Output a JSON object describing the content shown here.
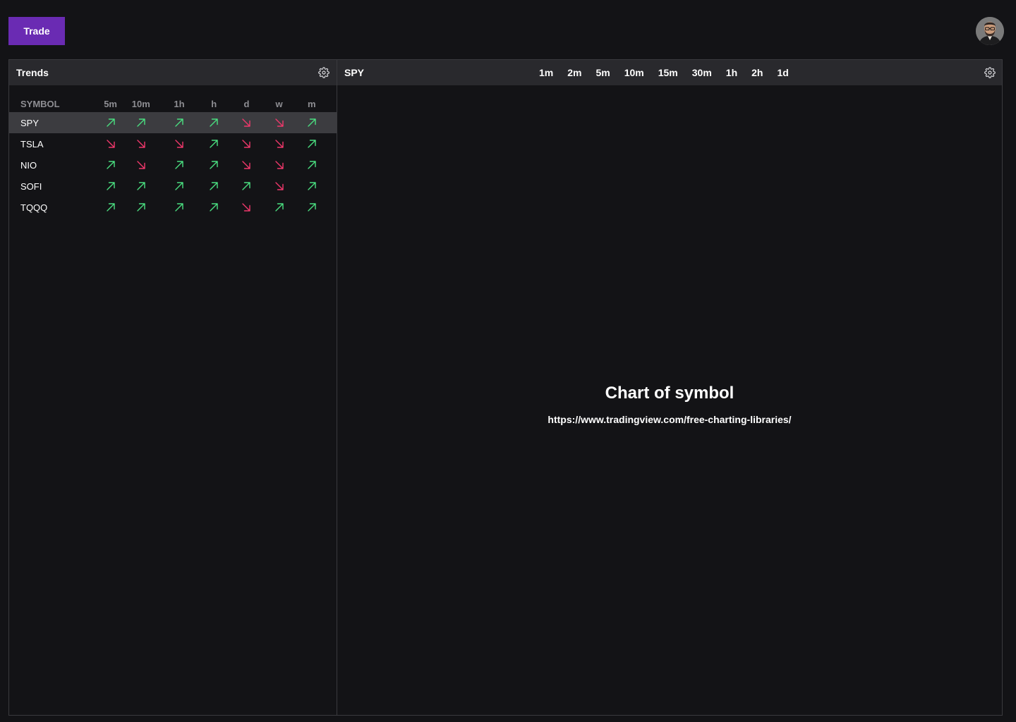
{
  "header": {
    "trade_label": "Trade",
    "avatar_icon": "user-avatar"
  },
  "trends_panel": {
    "title": "Trends",
    "settings_icon": "gear-icon",
    "columns": [
      "SYMBOL",
      "5m",
      "10m",
      "1h",
      "h",
      "d",
      "w",
      "m"
    ],
    "selected_symbol": "SPY",
    "rows": [
      {
        "symbol": "SPY",
        "trends": [
          "up",
          "up",
          "up",
          "up",
          "down",
          "down",
          "up"
        ]
      },
      {
        "symbol": "TSLA",
        "trends": [
          "down",
          "down",
          "down",
          "up",
          "down",
          "down",
          "up"
        ]
      },
      {
        "symbol": "NIO",
        "trends": [
          "up",
          "down",
          "up",
          "up",
          "down",
          "down",
          "up"
        ]
      },
      {
        "symbol": "SOFI",
        "trends": [
          "up",
          "up",
          "up",
          "up",
          "up",
          "down",
          "up"
        ]
      },
      {
        "symbol": "TQQQ",
        "trends": [
          "up",
          "up",
          "up",
          "up",
          "down",
          "up",
          "up"
        ]
      }
    ]
  },
  "chart_panel": {
    "symbol": "SPY",
    "timeframes": [
      "1m",
      "2m",
      "5m",
      "10m",
      "15m",
      "30m",
      "1h",
      "2h",
      "1d"
    ],
    "settings_icon": "gear-icon",
    "placeholder_title": "Chart of symbol",
    "placeholder_link": "https://www.tradingview.com/free-charting-libraries/"
  },
  "colors": {
    "up": "#4ade80",
    "down": "#f0386b",
    "accent": "#6a2bb3",
    "background": "#131316",
    "header_bg": "#29292d",
    "selected_row": "#3c3c40"
  }
}
